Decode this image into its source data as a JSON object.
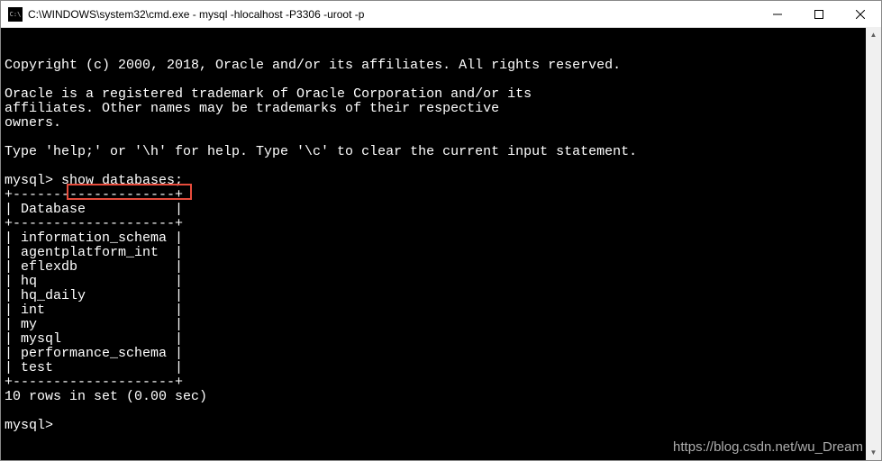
{
  "titlebar": {
    "title": "C:\\WINDOWS\\system32\\cmd.exe - mysql  -hlocalhost -P3306 -uroot -p"
  },
  "terminal": {
    "copyright": "Copyright (c) 2000, 2018, Oracle and/or its affiliates. All rights reserved.",
    "trademark1": "Oracle is a registered trademark of Oracle Corporation and/or its",
    "trademark2": "affiliates. Other names may be trademarks of their respective",
    "trademark3": "owners.",
    "help": "Type 'help;' or '\\h' for help. Type '\\c' to clear the current input statement.",
    "prompt1": "mysql>",
    "command": " show databases;",
    "border_top": "+--------------------+",
    "header": "| Database           |",
    "border_mid": "+--------------------+",
    "rows": [
      "| information_schema |",
      "| agentplatform_int  |",
      "| eflexdb            |",
      "| hq                 |",
      "| hq_daily           |",
      "| int                |",
      "| my                 |",
      "| mysql              |",
      "| performance_schema |",
      "| test               |"
    ],
    "border_bot": "+--------------------+",
    "result": "10 rows in set (0.00 sec)",
    "prompt2": "mysql>"
  },
  "watermark": "https://blog.csdn.net/wu_Dream"
}
